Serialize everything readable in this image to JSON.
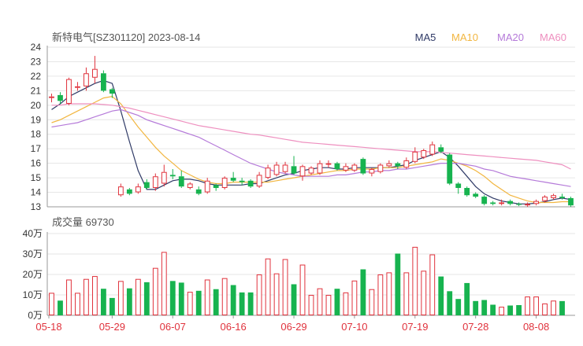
{
  "header": {
    "title": "新特电气[SZ301120] 2023-08-14",
    "ma_legend": [
      {
        "label": "MA5",
        "color": "#2f3a66"
      },
      {
        "label": "MA10",
        "color": "#f2b640"
      },
      {
        "label": "MA20",
        "color": "#b57ad9"
      },
      {
        "label": "MA60",
        "color": "#ee8fbf"
      }
    ]
  },
  "volume_header": {
    "label": "成交量 69730"
  },
  "colors": {
    "up": "#e0323c",
    "down": "#17b34f",
    "grid": "#e6e6e6",
    "axis": "#999999",
    "date_label": "#e0323c"
  },
  "chart_data": [
    {
      "type": "candlestick",
      "title": "新特电气[SZ301120] 2023-08-14",
      "ylim": [
        13,
        24
      ],
      "yticks": [
        13,
        14,
        15,
        16,
        17,
        18,
        19,
        20,
        21,
        22,
        23,
        24
      ],
      "up_style": "hollow red",
      "down_style": "filled green",
      "candles": [
        {
          "o": 20.5,
          "c": 20.6,
          "h": 20.8,
          "l": 20.2,
          "up": true
        },
        {
          "o": 20.7,
          "c": 20.3,
          "h": 20.9,
          "l": 20.1,
          "up": false
        },
        {
          "o": 20.1,
          "c": 21.8,
          "h": 21.9,
          "l": 20.0,
          "up": true
        },
        {
          "o": 21.2,
          "c": 21.3,
          "h": 21.6,
          "l": 21.0,
          "up": true
        },
        {
          "o": 21.3,
          "c": 22.2,
          "h": 22.6,
          "l": 21.0,
          "up": true
        },
        {
          "o": 21.9,
          "c": 22.5,
          "h": 23.4,
          "l": 21.5,
          "up": true
        },
        {
          "o": 22.2,
          "c": 21.0,
          "h": 22.4,
          "l": 20.9,
          "up": false
        },
        {
          "o": 21.1,
          "c": 20.8,
          "h": 21.2,
          "l": 20.5,
          "up": false
        },
        {
          "o": 13.8,
          "c": 14.4,
          "h": 14.6,
          "l": 13.7,
          "up": true
        },
        {
          "o": 14.2,
          "c": 13.9,
          "h": 14.3,
          "l": 13.8,
          "up": false
        },
        {
          "o": 14.0,
          "c": 14.4,
          "h": 14.6,
          "l": 13.9,
          "up": true
        },
        {
          "o": 14.7,
          "c": 14.3,
          "h": 14.9,
          "l": 14.2,
          "up": false
        },
        {
          "o": 14.3,
          "c": 15.1,
          "h": 15.3,
          "l": 14.1,
          "up": true
        },
        {
          "o": 14.6,
          "c": 15.4,
          "h": 15.9,
          "l": 14.4,
          "up": true
        },
        {
          "o": 15.2,
          "c": 15.1,
          "h": 15.6,
          "l": 14.9,
          "up": false
        },
        {
          "o": 15.1,
          "c": 14.4,
          "h": 15.5,
          "l": 14.3,
          "up": false
        },
        {
          "o": 14.3,
          "c": 14.6,
          "h": 14.7,
          "l": 14.2,
          "up": true
        },
        {
          "o": 14.2,
          "c": 13.9,
          "h": 14.4,
          "l": 13.8,
          "up": false
        },
        {
          "o": 14.0,
          "c": 14.8,
          "h": 15.0,
          "l": 13.9,
          "up": true
        },
        {
          "o": 14.5,
          "c": 14.3,
          "h": 14.6,
          "l": 14.1,
          "up": false
        },
        {
          "o": 14.3,
          "c": 15.0,
          "h": 15.1,
          "l": 14.2,
          "up": true
        },
        {
          "o": 15.0,
          "c": 14.8,
          "h": 15.4,
          "l": 14.7,
          "up": false
        },
        {
          "o": 14.8,
          "c": 14.7,
          "h": 15.0,
          "l": 14.5,
          "up": false
        },
        {
          "o": 14.8,
          "c": 14.4,
          "h": 14.9,
          "l": 14.3,
          "up": false
        },
        {
          "o": 14.4,
          "c": 15.2,
          "h": 15.4,
          "l": 14.3,
          "up": true
        },
        {
          "o": 15.0,
          "c": 15.7,
          "h": 15.9,
          "l": 14.9,
          "up": true
        },
        {
          "o": 15.2,
          "c": 15.9,
          "h": 16.1,
          "l": 15.1,
          "up": true
        },
        {
          "o": 15.4,
          "c": 15.9,
          "h": 16.1,
          "l": 15.3,
          "up": true
        },
        {
          "o": 15.8,
          "c": 15.3,
          "h": 16.5,
          "l": 15.2,
          "up": false
        },
        {
          "o": 15.1,
          "c": 15.8,
          "h": 15.9,
          "l": 14.8,
          "up": true
        },
        {
          "o": 15.3,
          "c": 15.7,
          "h": 15.8,
          "l": 15.2,
          "up": true
        },
        {
          "o": 15.3,
          "c": 16.0,
          "h": 16.2,
          "l": 15.2,
          "up": true
        },
        {
          "o": 15.9,
          "c": 16.0,
          "h": 16.2,
          "l": 15.7,
          "up": true
        },
        {
          "o": 16.0,
          "c": 15.6,
          "h": 16.1,
          "l": 15.5,
          "up": false
        },
        {
          "o": 15.5,
          "c": 15.8,
          "h": 16.0,
          "l": 15.4,
          "up": true
        },
        {
          "o": 15.5,
          "c": 15.9,
          "h": 16.0,
          "l": 15.4,
          "up": true
        },
        {
          "o": 16.3,
          "c": 15.3,
          "h": 16.4,
          "l": 15.2,
          "up": false
        },
        {
          "o": 15.3,
          "c": 15.6,
          "h": 15.7,
          "l": 15.1,
          "up": true
        },
        {
          "o": 15.4,
          "c": 15.9,
          "h": 16.0,
          "l": 15.3,
          "up": true
        },
        {
          "o": 15.8,
          "c": 16.0,
          "h": 16.2,
          "l": 15.7,
          "up": true
        },
        {
          "o": 16.0,
          "c": 15.8,
          "h": 16.1,
          "l": 15.6,
          "up": false
        },
        {
          "o": 15.7,
          "c": 16.2,
          "h": 16.4,
          "l": 15.6,
          "up": true
        },
        {
          "o": 16.1,
          "c": 16.8,
          "h": 17.1,
          "l": 16.0,
          "up": true
        },
        {
          "o": 16.4,
          "c": 16.9,
          "h": 17.0,
          "l": 16.3,
          "up": true
        },
        {
          "o": 16.6,
          "c": 17.3,
          "h": 17.5,
          "l": 16.5,
          "up": true
        },
        {
          "o": 17.1,
          "c": 16.8,
          "h": 17.3,
          "l": 16.7,
          "up": false
        },
        {
          "o": 16.6,
          "c": 14.6,
          "h": 16.7,
          "l": 14.5,
          "up": false
        },
        {
          "o": 14.6,
          "c": 14.3,
          "h": 14.7,
          "l": 13.9,
          "up": false
        },
        {
          "o": 14.3,
          "c": 13.8,
          "h": 14.4,
          "l": 13.7,
          "up": false
        },
        {
          "o": 13.9,
          "c": 13.7,
          "h": 14.0,
          "l": 13.6,
          "up": false
        },
        {
          "o": 13.7,
          "c": 13.2,
          "h": 13.8,
          "l": 13.1,
          "up": false
        },
        {
          "o": 13.3,
          "c": 13.2,
          "h": 13.4,
          "l": 13.1,
          "up": false
        },
        {
          "o": 13.2,
          "c": 13.3,
          "h": 13.5,
          "l": 13.1,
          "up": true
        },
        {
          "o": 13.4,
          "c": 13.2,
          "h": 13.5,
          "l": 13.1,
          "up": false
        },
        {
          "o": 13.2,
          "c": 13.15,
          "h": 13.3,
          "l": 13.05,
          "up": false
        },
        {
          "o": 13.1,
          "c": 13.2,
          "h": 13.3,
          "l": 13.0,
          "up": true
        },
        {
          "o": 13.2,
          "c": 13.4,
          "h": 13.5,
          "l": 13.1,
          "up": true
        },
        {
          "o": 13.4,
          "c": 13.7,
          "h": 13.8,
          "l": 13.3,
          "up": true
        },
        {
          "o": 13.6,
          "c": 13.8,
          "h": 13.9,
          "l": 13.5,
          "up": true
        },
        {
          "o": 13.7,
          "c": 13.6,
          "h": 13.9,
          "l": 13.5,
          "up": false
        },
        {
          "o": 13.6,
          "c": 13.1,
          "h": 13.7,
          "l": 13.0,
          "up": false
        }
      ],
      "ma_lines": [
        {
          "name": "MA5",
          "color": "#2f3a66",
          "values": [
            19.7,
            20.1,
            20.6,
            20.9,
            21.2,
            21.5,
            21.7,
            21.5,
            19.6,
            17.5,
            15.5,
            14.2,
            14.2,
            14.5,
            14.8,
            14.9,
            14.9,
            14.8,
            14.6,
            14.5,
            14.5,
            14.5,
            14.5,
            14.6,
            14.6,
            14.8,
            15.0,
            15.2,
            15.3,
            15.5,
            15.6,
            15.7,
            15.7,
            15.6,
            15.6,
            15.7,
            15.7,
            15.7,
            15.7,
            15.7,
            15.8,
            15.9,
            16.2,
            16.4,
            16.6,
            16.8,
            16.4,
            15.8,
            15.1,
            14.4,
            13.9,
            13.6,
            13.4,
            13.3,
            13.2,
            13.2,
            13.25,
            13.35,
            13.5,
            13.6,
            13.5
          ]
        },
        {
          "name": "MA10",
          "color": "#f2b640",
          "values": [
            18.8,
            19.0,
            19.3,
            19.6,
            19.9,
            20.2,
            20.5,
            20.6,
            20.1,
            19.3,
            18.5,
            17.8,
            17.1,
            16.5,
            16.0,
            15.5,
            15.2,
            14.9,
            14.7,
            14.6,
            14.6,
            14.7,
            14.7,
            14.7,
            14.7,
            14.7,
            14.8,
            14.9,
            15.0,
            15.1,
            15.2,
            15.3,
            15.4,
            15.5,
            15.5,
            15.6,
            15.6,
            15.6,
            15.7,
            15.7,
            15.7,
            15.8,
            15.9,
            16.0,
            16.1,
            16.3,
            16.2,
            16.0,
            15.8,
            15.5,
            15.1,
            14.6,
            14.2,
            13.8,
            13.6,
            13.4,
            13.3,
            13.3,
            13.3,
            13.35,
            13.35
          ]
        },
        {
          "name": "MA20",
          "color": "#b57ad9",
          "values": [
            18.5,
            18.6,
            18.7,
            18.8,
            19.0,
            19.2,
            19.4,
            19.6,
            19.7,
            19.5,
            19.3,
            19.0,
            18.8,
            18.6,
            18.4,
            18.2,
            18.0,
            17.8,
            17.5,
            17.2,
            16.9,
            16.6,
            16.3,
            16.0,
            15.8,
            15.6,
            15.4,
            15.3,
            15.2,
            15.1,
            15.1,
            15.1,
            15.1,
            15.2,
            15.2,
            15.3,
            15.4,
            15.4,
            15.5,
            15.5,
            15.6,
            15.6,
            15.7,
            15.8,
            15.9,
            16.0,
            16.0,
            16.0,
            15.9,
            15.8,
            15.6,
            15.5,
            15.3,
            15.1,
            15.0,
            14.9,
            14.8,
            14.7,
            14.6,
            14.5,
            14.4
          ]
        },
        {
          "name": "MA60",
          "color": "#ee8fbf",
          "values": [
            20.0,
            20.0,
            20.1,
            20.1,
            20.1,
            20.1,
            20.05,
            20.0,
            19.9,
            19.8,
            19.65,
            19.5,
            19.35,
            19.2,
            19.05,
            18.9,
            18.75,
            18.6,
            18.5,
            18.4,
            18.3,
            18.2,
            18.1,
            18.0,
            17.95,
            17.85,
            17.75,
            17.65,
            17.55,
            17.45,
            17.4,
            17.35,
            17.3,
            17.25,
            17.2,
            17.15,
            17.1,
            17.05,
            17.0,
            16.95,
            16.9,
            16.85,
            16.8,
            16.8,
            16.8,
            16.75,
            16.7,
            16.65,
            16.6,
            16.55,
            16.5,
            16.45,
            16.4,
            16.35,
            16.3,
            16.25,
            16.2,
            16.1,
            16.0,
            15.9,
            15.6
          ]
        }
      ]
    },
    {
      "type": "bar",
      "title": "成交量 69730",
      "ylim": [
        0,
        400000
      ],
      "ytick_values": [
        0,
        100000,
        200000,
        300000,
        400000
      ],
      "ytick_labels": [
        "0万",
        "10万",
        "20万",
        "30万",
        "40万"
      ],
      "values": [
        110000,
        72000,
        175000,
        110000,
        178000,
        192000,
        130000,
        85000,
        168000,
        132000,
        178000,
        162000,
        232000,
        310000,
        168000,
        160000,
        115000,
        120000,
        175000,
        128000,
        182000,
        148000,
        112000,
        112000,
        200000,
        278000,
        205000,
        275000,
        152000,
        248000,
        100000,
        132000,
        100000,
        130000,
        112000,
        170000,
        225000,
        128000,
        200000,
        210000,
        302000,
        210000,
        335000,
        218000,
        298000,
        190000,
        118000,
        80000,
        158000,
        70000,
        75000,
        52000,
        42000,
        48000,
        50000,
        92000,
        92000,
        58000,
        72000,
        69730
      ]
    }
  ],
  "x_axis": {
    "date_labels": [
      "05-18",
      "05-29",
      "06-07",
      "06-16",
      "06-29",
      "07-10",
      "07-19",
      "07-28",
      "08-08"
    ]
  }
}
